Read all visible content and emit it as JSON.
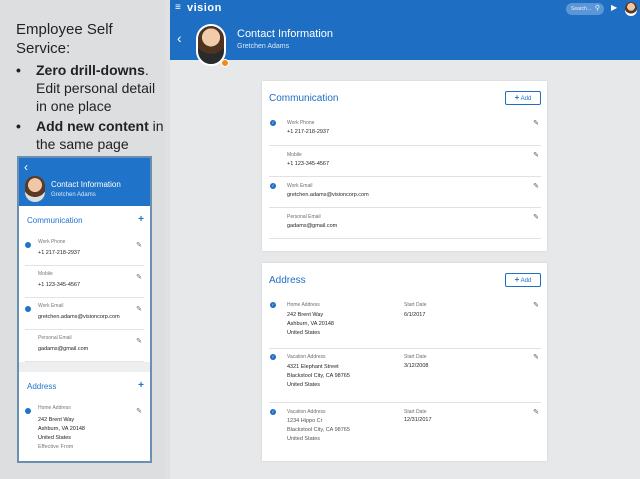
{
  "slide": {
    "title": "Employee Self Service:",
    "bullets": [
      {
        "bold": "Zero drill-downs",
        "rest": ". Edit personal detail in one place"
      },
      {
        "bold": "Add new content",
        "rest": " in the same page"
      }
    ]
  },
  "phone": {
    "title": "Contact Information",
    "subtitle": "Gretchen Adams",
    "communication_title": "Communication",
    "rows": [
      {
        "label": "Work Phone",
        "value": "+1 217-218-2937",
        "checked": true
      },
      {
        "label": "Mobile",
        "value": "+1 123-345-4567",
        "checked": false
      },
      {
        "label": "Work Email",
        "value": "gretchen.adams@visioncorp.com",
        "checked": true
      },
      {
        "label": "Personal Email",
        "value": "gadams@gmail.com",
        "checked": false
      }
    ],
    "address_title": "Address",
    "address": {
      "label": "Home Address",
      "line1": "242 Brent Way",
      "line2": "Ashburn, VA 20148",
      "line3": "United States",
      "line4": "Effective From"
    }
  },
  "app": {
    "brand": "vision",
    "search_placeholder": "Search...",
    "page_title": "Contact Information",
    "page_subtitle": "Gretchen Adams",
    "accent_color": "#1e6fc4"
  },
  "communication": {
    "title": "Communication",
    "add_label": "Add",
    "rows": [
      {
        "label": "Work Phone",
        "value": "+1 217-218-2937",
        "checked": true
      },
      {
        "label": "Mobile",
        "value": "+1 123-345-4567",
        "checked": false
      },
      {
        "label": "Work Email",
        "value": "gretchen.adams@visioncorp.com",
        "checked": true
      },
      {
        "label": "Personal Email",
        "value": "gadams@gmail.com",
        "checked": false
      }
    ]
  },
  "address": {
    "title": "Address",
    "add_label": "Add",
    "start_date_label": "Start Date",
    "rows": [
      {
        "label": "Home Address",
        "line1": "242 Brent Way",
        "line2": "Ashburn, VA 20148",
        "line3": "United States",
        "start_date": "6/1/2017",
        "checked": true
      },
      {
        "label": "Vacation Address",
        "line1": "4321 Elephant Street",
        "line2": "Blackstool City, CA 98765",
        "line3": "United States",
        "start_date": "3/12/2008",
        "checked": true
      },
      {
        "label": "Vacation Address",
        "line1": "1234 Hippo Cr",
        "line2": "Blackstool City, CA 98765",
        "line3": "United States",
        "start_date": "12/31/2017",
        "checked": true
      }
    ]
  }
}
